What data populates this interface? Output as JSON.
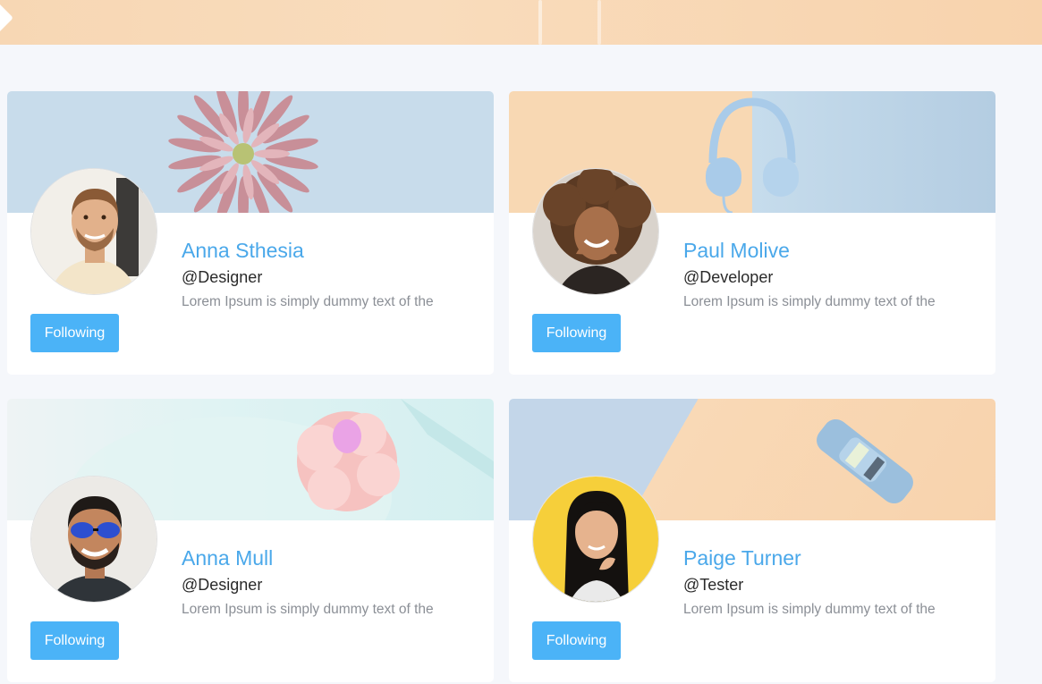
{
  "cards": [
    {
      "name": "Anna Sthesia",
      "handle": "@Designer",
      "bio": "Lorem Ipsum is simply dummy text of the",
      "button_label": "Following",
      "cover_icon": "flower-image",
      "avatar_icon": "man-smiling-avatar"
    },
    {
      "name": "Paul Molive",
      "handle": "@Developer",
      "bio": "Lorem Ipsum is simply dummy text of the",
      "button_label": "Following",
      "cover_icon": "headphones-image",
      "avatar_icon": "woman-curly-hair-avatar"
    },
    {
      "name": "Anna Mull",
      "handle": "@Designer",
      "bio": "Lorem Ipsum is simply dummy text of the",
      "button_label": "Following",
      "cover_icon": "cupcake-image",
      "avatar_icon": "man-sunglasses-avatar"
    },
    {
      "name": "Paige Turner",
      "handle": "@Tester",
      "bio": "Lorem Ipsum is simply dummy text of the",
      "button_label": "Following",
      "cover_icon": "toy-car-image",
      "avatar_icon": "woman-yellow-background-avatar"
    }
  ],
  "colors": {
    "accent": "#4bb3f7",
    "name_text": "#4aa8ea",
    "page_background": "#f5f7fb"
  }
}
